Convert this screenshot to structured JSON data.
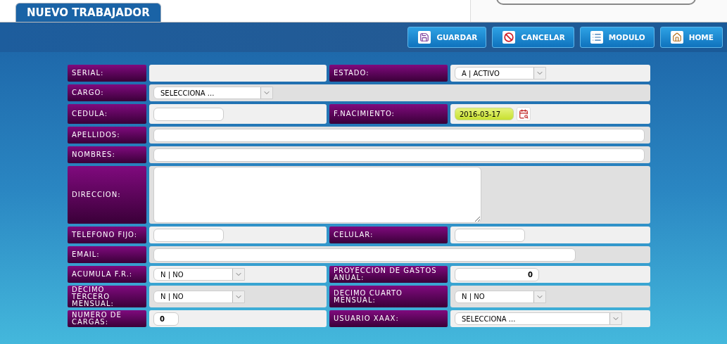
{
  "tab": {
    "label": "NUEVO TRABAJADOR",
    "selected": true
  },
  "toolbar": [
    {
      "kind": "save",
      "label": "GUARDAR"
    },
    {
      "kind": "cancel",
      "label": "CANCELAR"
    },
    {
      "kind": "module",
      "label": "MODULO"
    },
    {
      "kind": "home",
      "label": "HOME"
    }
  ],
  "rows": [
    {
      "cells": [
        {
          "label": "SERIAL:",
          "field": {
            "kind": "empty"
          }
        },
        {
          "label": "ESTADO:",
          "field": {
            "kind": "select",
            "value": "A | ACTIVO"
          }
        }
      ]
    },
    {
      "cells": [
        {
          "label": "CARGO:",
          "field": {
            "kind": "select",
            "value": "SELECCIONA ...",
            "span": true
          }
        }
      ]
    },
    {
      "cells": [
        {
          "label": "CEDULA:",
          "field": {
            "kind": "input"
          }
        },
        {
          "label": "F.NACIMIENTO:",
          "field": {
            "kind": "date",
            "value": "2016-03-17"
          }
        }
      ]
    },
    {
      "cells": [
        {
          "label": "APELLIDOS:",
          "field": {
            "kind": "input",
            "span": true
          }
        }
      ]
    },
    {
      "cells": [
        {
          "label": "NOMBRES:",
          "field": {
            "kind": "input",
            "span": true
          }
        }
      ]
    },
    {
      "cells": [
        {
          "label": "DIRECCION:",
          "field": {
            "kind": "textarea",
            "span": true
          }
        }
      ]
    },
    {
      "cells": [
        {
          "label": "TELEFONO FIJO:",
          "field": {
            "kind": "input"
          }
        },
        {
          "label": "CELULAR:",
          "field": {
            "kind": "input"
          }
        }
      ]
    },
    {
      "cells": [
        {
          "label": "EMAIL:",
          "field": {
            "kind": "input",
            "span": true
          }
        }
      ]
    },
    {
      "cells": [
        {
          "label": "ACUMULA F.R.:",
          "field": {
            "kind": "select",
            "value": "N | NO"
          }
        },
        {
          "label": "PROYECCION DE GASTOS ANUAL:",
          "field": {
            "kind": "number",
            "value": "0"
          }
        }
      ]
    },
    {
      "cells": [
        {
          "label": "DECIMO TERCERO MENSUAL:",
          "field": {
            "kind": "select",
            "value": "N | NO"
          }
        },
        {
          "label": "DECIMO CUARTO MENSUAL:",
          "field": {
            "kind": "select",
            "value": "N | NO"
          }
        }
      ]
    },
    {
      "cells": [
        {
          "label": "NUMERO DE CARGAS:",
          "field": {
            "kind": "short",
            "value": "0"
          }
        },
        {
          "label": "USUARIO XAAX:",
          "field": {
            "kind": "select",
            "value": "SELECCIONA ..."
          }
        }
      ]
    }
  ]
}
